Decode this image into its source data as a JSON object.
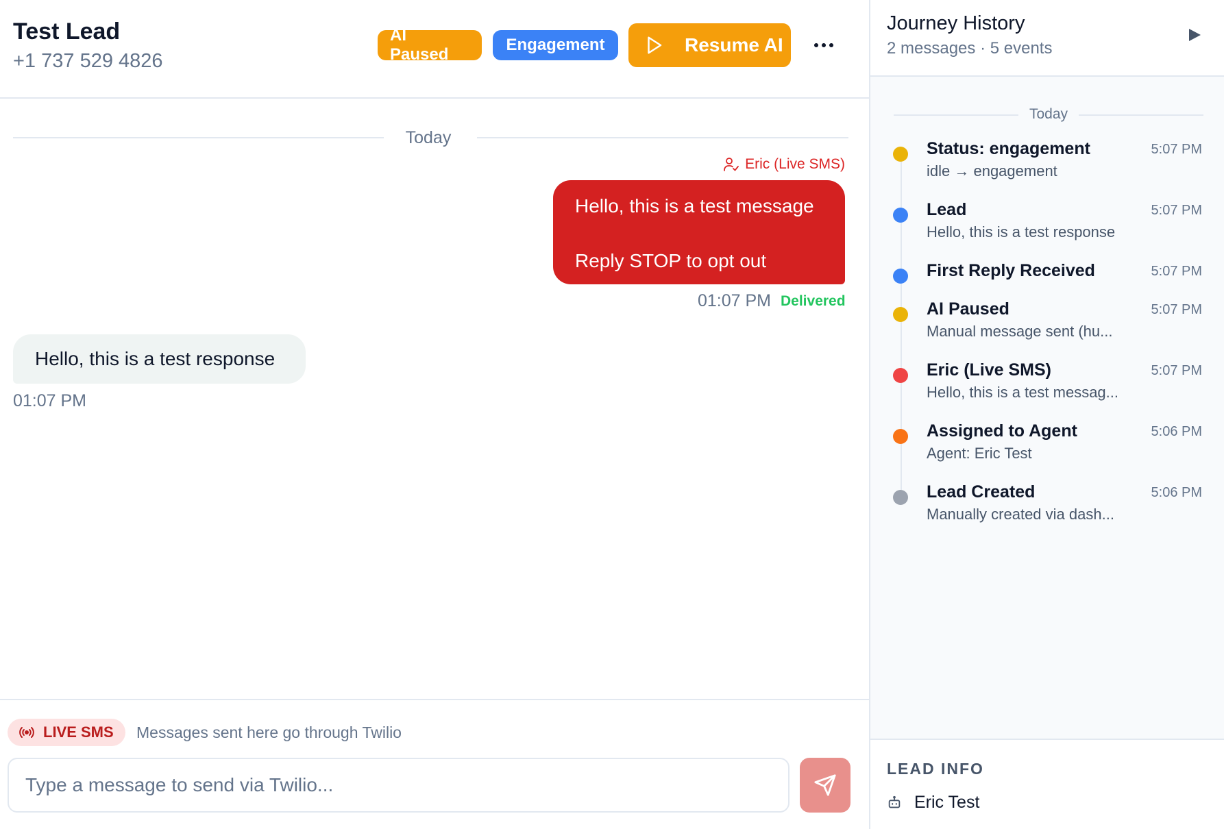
{
  "lead": {
    "name": "Test Lead",
    "phone": "+1 737 529 4826"
  },
  "header": {
    "status_badge": "AI Paused",
    "stage_badge": "Engagement",
    "resume_label": "Resume AI",
    "more_icon": "ellipsis-icon"
  },
  "chat": {
    "date_label": "Today",
    "outgoing": {
      "sender": "Eric (Live SMS)",
      "line1": "Hello, this is a test message",
      "line2": "Reply STOP to opt out",
      "time": "01:07 PM",
      "status": "Delivered"
    },
    "incoming": {
      "text": "Hello, this is a test response",
      "time": "01:07 PM"
    }
  },
  "composer": {
    "badge": "LIVE SMS",
    "note": "Messages sent here go through Twilio",
    "placeholder": "Type a message to send via Twilio..."
  },
  "panel": {
    "title": "Journey History",
    "subtitle": "2 messages · 5 events",
    "date_label": "Today",
    "events": [
      {
        "title": "Status: engagement",
        "desc": "idle → engagement",
        "time": "5:07 PM",
        "color": "#eab308"
      },
      {
        "title": "Lead",
        "desc": "Hello, this is a test response",
        "time": "5:07 PM",
        "color": "#3b82f6"
      },
      {
        "title": "First Reply Received",
        "desc": "",
        "time": "5:07 PM",
        "color": "#3b82f6"
      },
      {
        "title": "AI Paused",
        "desc": "Manual message sent (hu...",
        "time": "5:07 PM",
        "color": "#eab308"
      },
      {
        "title": "Eric (Live SMS)",
        "desc": "Hello, this is a test messag...",
        "time": "5:07 PM",
        "color": "#ef4444"
      },
      {
        "title": "Assigned to Agent",
        "desc": "Agent: Eric Test",
        "time": "5:06 PM",
        "color": "#f97316"
      },
      {
        "title": "Lead Created",
        "desc": "Manually created via dash...",
        "time": "5:06 PM",
        "color": "#9ca3af"
      }
    ],
    "lead_info": {
      "title": "LEAD INFO",
      "agent": "Eric Test"
    }
  },
  "colors": {
    "accent_orange": "#f59e0b",
    "accent_blue": "#3b82f6",
    "outgoing_bubble": "#d42121",
    "incoming_bubble": "#eff4f3",
    "delivered": "#22c55e"
  }
}
